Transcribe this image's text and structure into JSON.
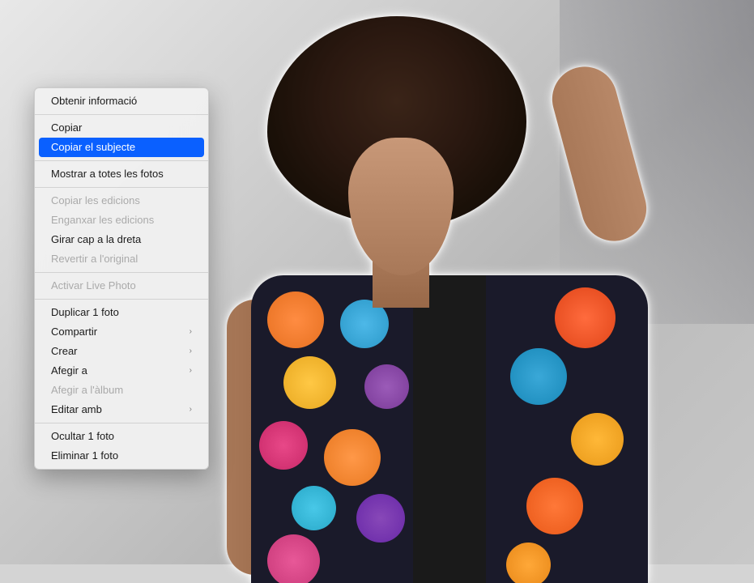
{
  "contextMenu": {
    "items": [
      {
        "label": "Obtenir informació",
        "enabled": true,
        "submenu": false,
        "highlighted": false
      },
      {
        "separator": true
      },
      {
        "label": "Copiar",
        "enabled": true,
        "submenu": false,
        "highlighted": false
      },
      {
        "label": "Copiar el subjecte",
        "enabled": true,
        "submenu": false,
        "highlighted": true
      },
      {
        "separator": true
      },
      {
        "label": "Mostrar a totes les fotos",
        "enabled": true,
        "submenu": false,
        "highlighted": false
      },
      {
        "separator": true
      },
      {
        "label": "Copiar les edicions",
        "enabled": false,
        "submenu": false,
        "highlighted": false
      },
      {
        "label": "Enganxar les edicions",
        "enabled": false,
        "submenu": false,
        "highlighted": false
      },
      {
        "label": "Girar cap a la dreta",
        "enabled": true,
        "submenu": false,
        "highlighted": false
      },
      {
        "label": "Revertir a l'original",
        "enabled": false,
        "submenu": false,
        "highlighted": false
      },
      {
        "separator": true
      },
      {
        "label": "Activar Live Photo",
        "enabled": false,
        "submenu": false,
        "highlighted": false
      },
      {
        "separator": true
      },
      {
        "label": "Duplicar 1 foto",
        "enabled": true,
        "submenu": false,
        "highlighted": false
      },
      {
        "label": "Compartir",
        "enabled": true,
        "submenu": true,
        "highlighted": false
      },
      {
        "label": "Crear",
        "enabled": true,
        "submenu": true,
        "highlighted": false
      },
      {
        "label": "Afegir a",
        "enabled": true,
        "submenu": true,
        "highlighted": false
      },
      {
        "label": "Afegir a l'àlbum",
        "enabled": false,
        "submenu": false,
        "highlighted": false
      },
      {
        "label": "Editar amb",
        "enabled": true,
        "submenu": true,
        "highlighted": false
      },
      {
        "separator": true
      },
      {
        "label": "Ocultar 1 foto",
        "enabled": true,
        "submenu": false,
        "highlighted": false
      },
      {
        "label": "Eliminar 1 foto",
        "enabled": true,
        "submenu": false,
        "highlighted": false
      }
    ]
  },
  "submenuArrow": "›"
}
